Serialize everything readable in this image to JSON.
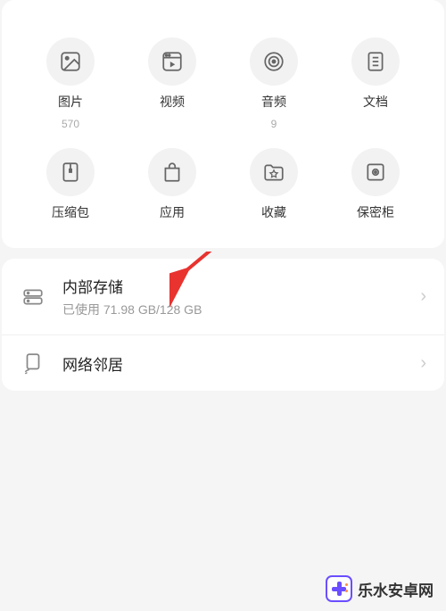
{
  "categories": [
    {
      "label": "图片",
      "count": "570",
      "icon": "image-icon"
    },
    {
      "label": "视频",
      "count": "",
      "icon": "video-icon"
    },
    {
      "label": "音频",
      "count": "9",
      "icon": "audio-icon"
    },
    {
      "label": "文档",
      "count": "",
      "icon": "document-icon"
    },
    {
      "label": "压缩包",
      "count": "",
      "icon": "archive-icon"
    },
    {
      "label": "应用",
      "count": "",
      "icon": "app-icon"
    },
    {
      "label": "收藏",
      "count": "",
      "icon": "favorite-icon"
    },
    {
      "label": "保密柜",
      "count": "",
      "icon": "safe-icon"
    }
  ],
  "storage": {
    "title": "内部存储",
    "subtitle": "已使用 71.98 GB/128 GB"
  },
  "network": {
    "title": "网络邻居"
  },
  "watermark": "乐水安卓网"
}
